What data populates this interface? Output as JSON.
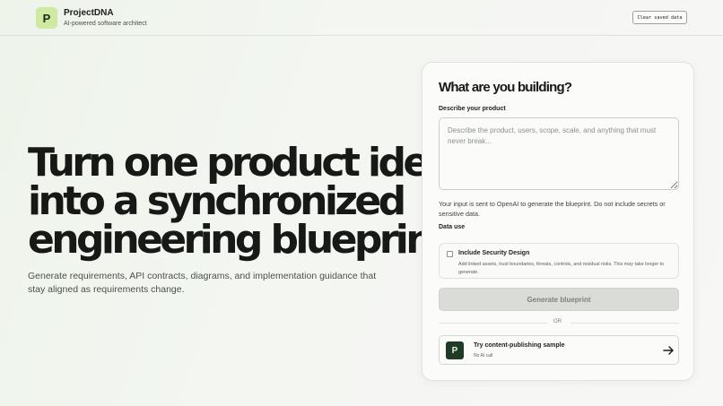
{
  "header": {
    "logo_letter": "P",
    "app_name": "ProjectDNA",
    "tagline": "AI-powered software architect",
    "clear_label": "Clear saved data"
  },
  "hero": {
    "lines": [
      "Turn one product idea",
      "into a synchronized",
      "engineering blueprint."
    ],
    "subtitle": "Generate requirements, API contracts, diagrams, and implementation guidance that stay aligned as requirements change."
  },
  "form": {
    "title": "What are you building?",
    "describe_label": "Describe your product",
    "placeholder": "Describe the product, users, scope, scale, and anything that must never break...",
    "value": "",
    "notice": "Your input is sent to OpenAI to generate the blueprint. Do not include secrets or sensitive data.",
    "data_use_label": "Data use",
    "security": {
      "title": "Include Security Design",
      "description": "Add linked assets, trust boundaries, threats, controls, and residual risks. This may take longer to generate.",
      "checked": false
    },
    "generate_label": "Generate blueprint",
    "or_label": "OR",
    "sample": {
      "logo_letter": "P",
      "title": "Try content-publishing sample",
      "subtitle": "No AI call"
    }
  },
  "colors": {
    "accent": "#cfe9a0",
    "sample_logo": "#1f3a26",
    "button_disabled": "#d9dcd7"
  },
  "icons": {
    "sample_arrow": "arrow-right-icon"
  }
}
